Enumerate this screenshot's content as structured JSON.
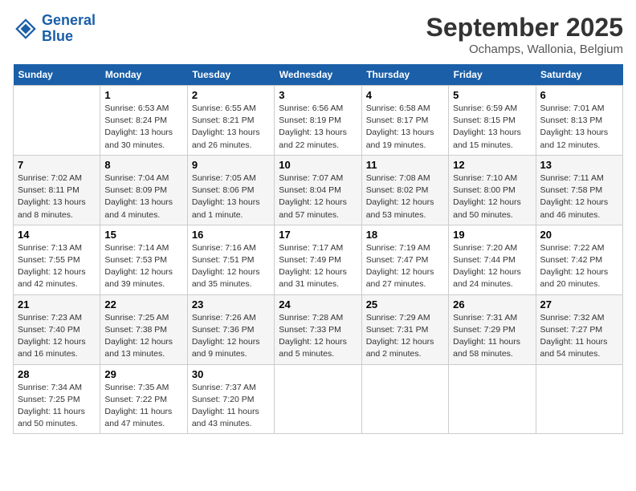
{
  "logo": {
    "line1": "General",
    "line2": "Blue"
  },
  "title": "September 2025",
  "location": "Ochamps, Wallonia, Belgium",
  "weekdays": [
    "Sunday",
    "Monday",
    "Tuesday",
    "Wednesday",
    "Thursday",
    "Friday",
    "Saturday"
  ],
  "weeks": [
    [
      {
        "day": "",
        "info": ""
      },
      {
        "day": "1",
        "info": "Sunrise: 6:53 AM\nSunset: 8:24 PM\nDaylight: 13 hours\nand 30 minutes."
      },
      {
        "day": "2",
        "info": "Sunrise: 6:55 AM\nSunset: 8:21 PM\nDaylight: 13 hours\nand 26 minutes."
      },
      {
        "day": "3",
        "info": "Sunrise: 6:56 AM\nSunset: 8:19 PM\nDaylight: 13 hours\nand 22 minutes."
      },
      {
        "day": "4",
        "info": "Sunrise: 6:58 AM\nSunset: 8:17 PM\nDaylight: 13 hours\nand 19 minutes."
      },
      {
        "day": "5",
        "info": "Sunrise: 6:59 AM\nSunset: 8:15 PM\nDaylight: 13 hours\nand 15 minutes."
      },
      {
        "day": "6",
        "info": "Sunrise: 7:01 AM\nSunset: 8:13 PM\nDaylight: 13 hours\nand 12 minutes."
      }
    ],
    [
      {
        "day": "7",
        "info": "Sunrise: 7:02 AM\nSunset: 8:11 PM\nDaylight: 13 hours\nand 8 minutes."
      },
      {
        "day": "8",
        "info": "Sunrise: 7:04 AM\nSunset: 8:09 PM\nDaylight: 13 hours\nand 4 minutes."
      },
      {
        "day": "9",
        "info": "Sunrise: 7:05 AM\nSunset: 8:06 PM\nDaylight: 13 hours\nand 1 minute."
      },
      {
        "day": "10",
        "info": "Sunrise: 7:07 AM\nSunset: 8:04 PM\nDaylight: 12 hours\nand 57 minutes."
      },
      {
        "day": "11",
        "info": "Sunrise: 7:08 AM\nSunset: 8:02 PM\nDaylight: 12 hours\nand 53 minutes."
      },
      {
        "day": "12",
        "info": "Sunrise: 7:10 AM\nSunset: 8:00 PM\nDaylight: 12 hours\nand 50 minutes."
      },
      {
        "day": "13",
        "info": "Sunrise: 7:11 AM\nSunset: 7:58 PM\nDaylight: 12 hours\nand 46 minutes."
      }
    ],
    [
      {
        "day": "14",
        "info": "Sunrise: 7:13 AM\nSunset: 7:55 PM\nDaylight: 12 hours\nand 42 minutes."
      },
      {
        "day": "15",
        "info": "Sunrise: 7:14 AM\nSunset: 7:53 PM\nDaylight: 12 hours\nand 39 minutes."
      },
      {
        "day": "16",
        "info": "Sunrise: 7:16 AM\nSunset: 7:51 PM\nDaylight: 12 hours\nand 35 minutes."
      },
      {
        "day": "17",
        "info": "Sunrise: 7:17 AM\nSunset: 7:49 PM\nDaylight: 12 hours\nand 31 minutes."
      },
      {
        "day": "18",
        "info": "Sunrise: 7:19 AM\nSunset: 7:47 PM\nDaylight: 12 hours\nand 27 minutes."
      },
      {
        "day": "19",
        "info": "Sunrise: 7:20 AM\nSunset: 7:44 PM\nDaylight: 12 hours\nand 24 minutes."
      },
      {
        "day": "20",
        "info": "Sunrise: 7:22 AM\nSunset: 7:42 PM\nDaylight: 12 hours\nand 20 minutes."
      }
    ],
    [
      {
        "day": "21",
        "info": "Sunrise: 7:23 AM\nSunset: 7:40 PM\nDaylight: 12 hours\nand 16 minutes."
      },
      {
        "day": "22",
        "info": "Sunrise: 7:25 AM\nSunset: 7:38 PM\nDaylight: 12 hours\nand 13 minutes."
      },
      {
        "day": "23",
        "info": "Sunrise: 7:26 AM\nSunset: 7:36 PM\nDaylight: 12 hours\nand 9 minutes."
      },
      {
        "day": "24",
        "info": "Sunrise: 7:28 AM\nSunset: 7:33 PM\nDaylight: 12 hours\nand 5 minutes."
      },
      {
        "day": "25",
        "info": "Sunrise: 7:29 AM\nSunset: 7:31 PM\nDaylight: 12 hours\nand 2 minutes."
      },
      {
        "day": "26",
        "info": "Sunrise: 7:31 AM\nSunset: 7:29 PM\nDaylight: 11 hours\nand 58 minutes."
      },
      {
        "day": "27",
        "info": "Sunrise: 7:32 AM\nSunset: 7:27 PM\nDaylight: 11 hours\nand 54 minutes."
      }
    ],
    [
      {
        "day": "28",
        "info": "Sunrise: 7:34 AM\nSunset: 7:25 PM\nDaylight: 11 hours\nand 50 minutes."
      },
      {
        "day": "29",
        "info": "Sunrise: 7:35 AM\nSunset: 7:22 PM\nDaylight: 11 hours\nand 47 minutes."
      },
      {
        "day": "30",
        "info": "Sunrise: 7:37 AM\nSunset: 7:20 PM\nDaylight: 11 hours\nand 43 minutes."
      },
      {
        "day": "",
        "info": ""
      },
      {
        "day": "",
        "info": ""
      },
      {
        "day": "",
        "info": ""
      },
      {
        "day": "",
        "info": ""
      }
    ]
  ]
}
